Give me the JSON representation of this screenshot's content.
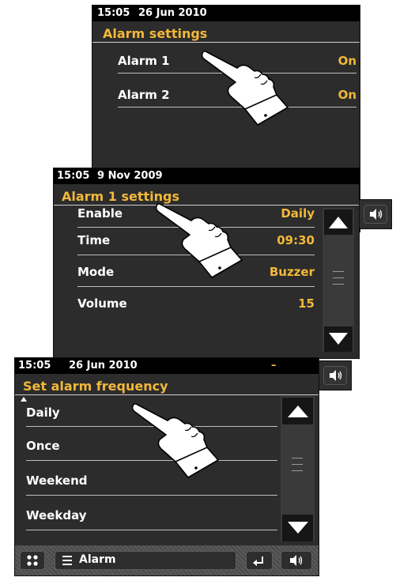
{
  "screen1": {
    "status": {
      "time": "15:05",
      "date": "26 Jun 2010"
    },
    "title": "Alarm settings",
    "rows": [
      {
        "label": "Alarm 1",
        "value": "On"
      },
      {
        "label": "Alarm 2",
        "value": "On"
      }
    ]
  },
  "screen2": {
    "status": {
      "time": "15:05",
      "date": "9 Nov 2009"
    },
    "title": "Alarm 1 settings",
    "rows": [
      {
        "label": "Enable",
        "value": "Daily"
      },
      {
        "label": "Time",
        "value": "09:30"
      },
      {
        "label": "Mode",
        "value": "Buzzer"
      },
      {
        "label": "Volume",
        "value": "15"
      }
    ]
  },
  "screen3": {
    "status": {
      "time": "15:05",
      "date": "26 Jun 2010"
    },
    "title": "Set alarm frequency",
    "rows": [
      {
        "label": "Daily"
      },
      {
        "label": "Once"
      },
      {
        "label": "Weekend"
      },
      {
        "label": "Weekday"
      }
    ],
    "bottom": {
      "menu_label": "Alarm"
    }
  },
  "icons": [
    "speaker-volume-icon",
    "scroll-up-arrow-icon",
    "scroll-down-arrow-icon",
    "grid-icon",
    "menu-icon",
    "back-arrow-icon",
    "pointing-hand-icon"
  ],
  "colors": {
    "accent": "#f2b83a",
    "screen_bg": "#2c2c2c",
    "statusbar_bg": "#000000"
  }
}
